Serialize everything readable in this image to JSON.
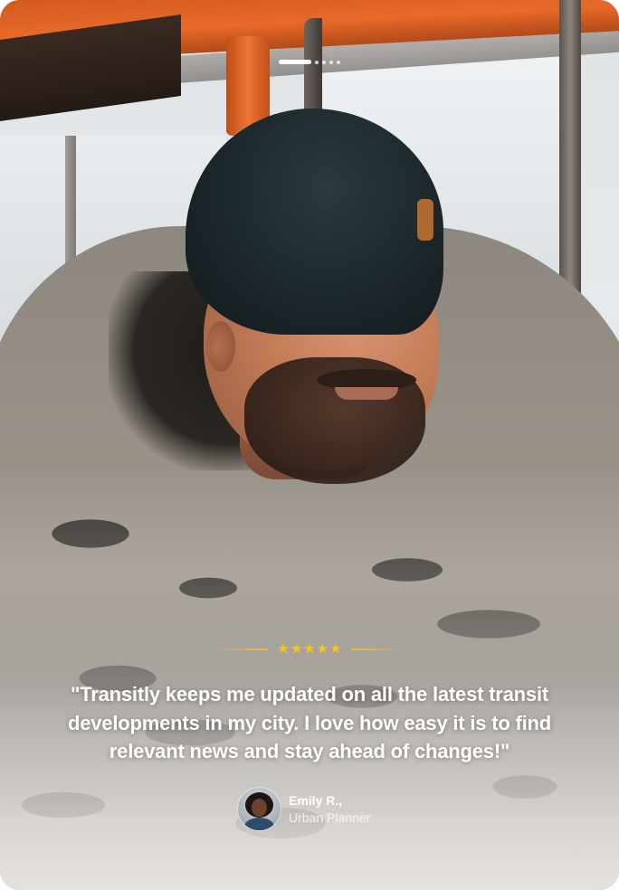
{
  "carousel": {
    "slide_count": 5,
    "active_index": 0
  },
  "rating": {
    "stars": 5,
    "max_stars": 5,
    "star_glyph": "★",
    "accent_color": "#f9c31c"
  },
  "testimonial": {
    "quote": "\"Transitly keeps me updated on all the latest transit developments in my city. I love how easy it is to find relevant news and stay ahead of changes!\""
  },
  "author": {
    "name": "Emily R.,",
    "role": "Urban Planner"
  }
}
